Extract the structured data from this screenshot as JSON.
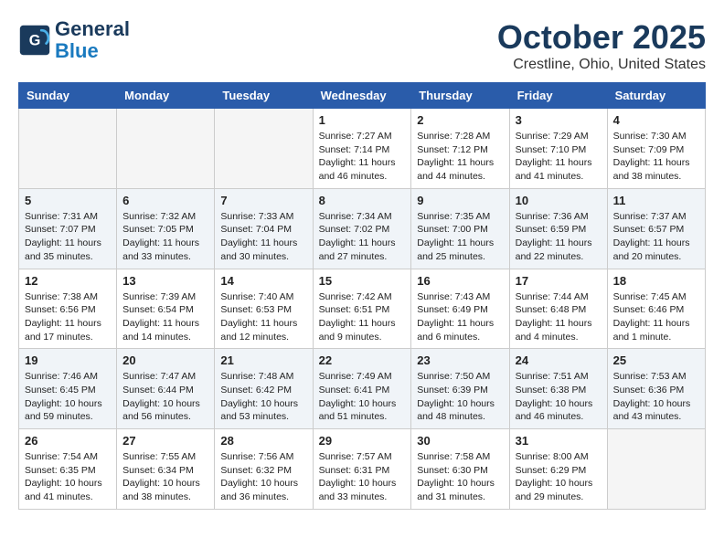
{
  "header": {
    "logo_line1": "General",
    "logo_line2": "Blue",
    "month": "October 2025",
    "location": "Crestline, Ohio, United States"
  },
  "days_of_week": [
    "Sunday",
    "Monday",
    "Tuesday",
    "Wednesday",
    "Thursday",
    "Friday",
    "Saturday"
  ],
  "weeks": [
    [
      {
        "day": "",
        "info": ""
      },
      {
        "day": "",
        "info": ""
      },
      {
        "day": "",
        "info": ""
      },
      {
        "day": "1",
        "info": "Sunrise: 7:27 AM\nSunset: 7:14 PM\nDaylight: 11 hours and 46 minutes."
      },
      {
        "day": "2",
        "info": "Sunrise: 7:28 AM\nSunset: 7:12 PM\nDaylight: 11 hours and 44 minutes."
      },
      {
        "day": "3",
        "info": "Sunrise: 7:29 AM\nSunset: 7:10 PM\nDaylight: 11 hours and 41 minutes."
      },
      {
        "day": "4",
        "info": "Sunrise: 7:30 AM\nSunset: 7:09 PM\nDaylight: 11 hours and 38 minutes."
      }
    ],
    [
      {
        "day": "5",
        "info": "Sunrise: 7:31 AM\nSunset: 7:07 PM\nDaylight: 11 hours and 35 minutes."
      },
      {
        "day": "6",
        "info": "Sunrise: 7:32 AM\nSunset: 7:05 PM\nDaylight: 11 hours and 33 minutes."
      },
      {
        "day": "7",
        "info": "Sunrise: 7:33 AM\nSunset: 7:04 PM\nDaylight: 11 hours and 30 minutes."
      },
      {
        "day": "8",
        "info": "Sunrise: 7:34 AM\nSunset: 7:02 PM\nDaylight: 11 hours and 27 minutes."
      },
      {
        "day": "9",
        "info": "Sunrise: 7:35 AM\nSunset: 7:00 PM\nDaylight: 11 hours and 25 minutes."
      },
      {
        "day": "10",
        "info": "Sunrise: 7:36 AM\nSunset: 6:59 PM\nDaylight: 11 hours and 22 minutes."
      },
      {
        "day": "11",
        "info": "Sunrise: 7:37 AM\nSunset: 6:57 PM\nDaylight: 11 hours and 20 minutes."
      }
    ],
    [
      {
        "day": "12",
        "info": "Sunrise: 7:38 AM\nSunset: 6:56 PM\nDaylight: 11 hours and 17 minutes."
      },
      {
        "day": "13",
        "info": "Sunrise: 7:39 AM\nSunset: 6:54 PM\nDaylight: 11 hours and 14 minutes."
      },
      {
        "day": "14",
        "info": "Sunrise: 7:40 AM\nSunset: 6:53 PM\nDaylight: 11 hours and 12 minutes."
      },
      {
        "day": "15",
        "info": "Sunrise: 7:42 AM\nSunset: 6:51 PM\nDaylight: 11 hours and 9 minutes."
      },
      {
        "day": "16",
        "info": "Sunrise: 7:43 AM\nSunset: 6:49 PM\nDaylight: 11 hours and 6 minutes."
      },
      {
        "day": "17",
        "info": "Sunrise: 7:44 AM\nSunset: 6:48 PM\nDaylight: 11 hours and 4 minutes."
      },
      {
        "day": "18",
        "info": "Sunrise: 7:45 AM\nSunset: 6:46 PM\nDaylight: 11 hours and 1 minute."
      }
    ],
    [
      {
        "day": "19",
        "info": "Sunrise: 7:46 AM\nSunset: 6:45 PM\nDaylight: 10 hours and 59 minutes."
      },
      {
        "day": "20",
        "info": "Sunrise: 7:47 AM\nSunset: 6:44 PM\nDaylight: 10 hours and 56 minutes."
      },
      {
        "day": "21",
        "info": "Sunrise: 7:48 AM\nSunset: 6:42 PM\nDaylight: 10 hours and 53 minutes."
      },
      {
        "day": "22",
        "info": "Sunrise: 7:49 AM\nSunset: 6:41 PM\nDaylight: 10 hours and 51 minutes."
      },
      {
        "day": "23",
        "info": "Sunrise: 7:50 AM\nSunset: 6:39 PM\nDaylight: 10 hours and 48 minutes."
      },
      {
        "day": "24",
        "info": "Sunrise: 7:51 AM\nSunset: 6:38 PM\nDaylight: 10 hours and 46 minutes."
      },
      {
        "day": "25",
        "info": "Sunrise: 7:53 AM\nSunset: 6:36 PM\nDaylight: 10 hours and 43 minutes."
      }
    ],
    [
      {
        "day": "26",
        "info": "Sunrise: 7:54 AM\nSunset: 6:35 PM\nDaylight: 10 hours and 41 minutes."
      },
      {
        "day": "27",
        "info": "Sunrise: 7:55 AM\nSunset: 6:34 PM\nDaylight: 10 hours and 38 minutes."
      },
      {
        "day": "28",
        "info": "Sunrise: 7:56 AM\nSunset: 6:32 PM\nDaylight: 10 hours and 36 minutes."
      },
      {
        "day": "29",
        "info": "Sunrise: 7:57 AM\nSunset: 6:31 PM\nDaylight: 10 hours and 33 minutes."
      },
      {
        "day": "30",
        "info": "Sunrise: 7:58 AM\nSunset: 6:30 PM\nDaylight: 10 hours and 31 minutes."
      },
      {
        "day": "31",
        "info": "Sunrise: 8:00 AM\nSunset: 6:29 PM\nDaylight: 10 hours and 29 minutes."
      },
      {
        "day": "",
        "info": ""
      }
    ]
  ]
}
